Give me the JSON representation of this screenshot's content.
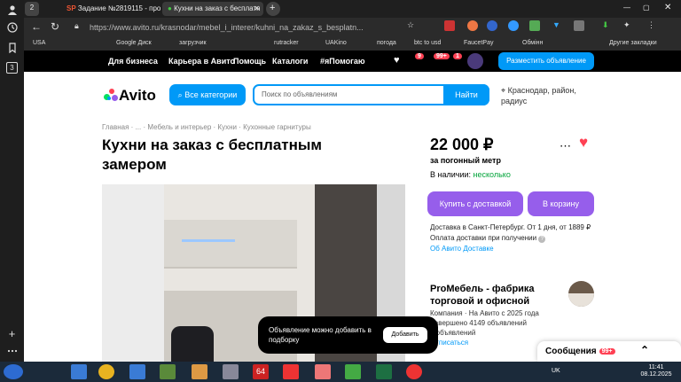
{
  "sidebar": {
    "icons": [
      "user-icon",
      "history-icon",
      "bookmark-icon",
      "window-icon"
    ],
    "window_count": "3"
  },
  "tabs": {
    "tab_count": "2",
    "items": [
      {
        "label": "Задание №2819115 - про",
        "favicon": "SP"
      },
      {
        "label": "Кухни на заказ с бесплатн"
      }
    ],
    "new_tab": "+"
  },
  "address": {
    "url": "https://www.avito.ru/krasnodar/mebel_i_interer/kuhni_na_zakaz_s_besplatn..."
  },
  "bookmarks": {
    "items": [
      "USA",
      "Google Диск",
      "загрузчик",
      "rutracker",
      "UAKino",
      "погода",
      "btc to usd",
      "FaucetPay",
      "Обмінн"
    ],
    "other": "Другие закладки"
  },
  "avito_nav": {
    "items": [
      "Для бизнеса",
      "Карьера в Авито",
      "Помощь",
      "Каталоги",
      "#яПомогаю"
    ],
    "badges": [
      "9",
      "99+",
      "1"
    ],
    "post_button": "Разместить объявление"
  },
  "header": {
    "logo": "Avito",
    "categories_button": "Все категории",
    "search_placeholder": "Поиск по объявлениям",
    "search_button": "Найти",
    "location": "Краснодар, район, радиус"
  },
  "breadcrumbs": [
    "Главная",
    "...",
    "Мебель и интерьер",
    "Кухни",
    "Кухонные гарнитуры"
  ],
  "listing": {
    "title": "Кухни на заказ с бесплатным замером",
    "price": "22 000 ₽",
    "price_unit": "за погонный метр",
    "stock_label": "В наличии:",
    "stock_value": "несколько",
    "buy_delivery": "Купить с доставкой",
    "to_cart": "В корзину",
    "delivery_text": "Доставка в Санкт-Петербург. От 1 дня, от 1889 ₽",
    "payment_text": "Оплата доставки при получении",
    "delivery_link": "Об Авито Доставке"
  },
  "seller": {
    "name": "ProМебель - фабрика торговой и офисной",
    "meta": "Компания · На Авито с 2025 года",
    "completed": "Завершено 4149 объявлений",
    "active": "3 объявлений",
    "unsubscribe": "Отписаться"
  },
  "toast": {
    "message": "Объявление можно добавить в подборку",
    "button": "Добавить"
  },
  "messages": {
    "label": "Сообщения",
    "badge": "99+"
  },
  "taskbar": {
    "lang": "UK",
    "time": "11:41",
    "date": "08.12.2025",
    "badge": "64"
  }
}
